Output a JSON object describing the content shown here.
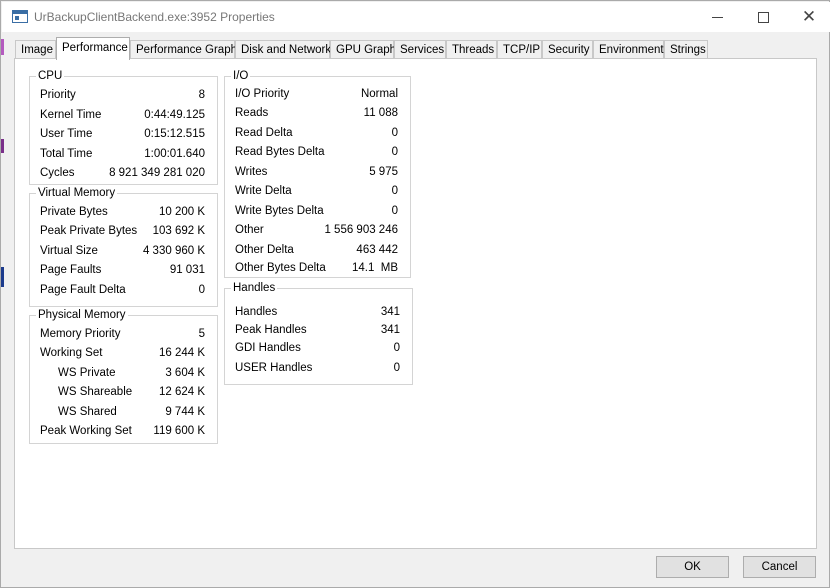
{
  "window": {
    "title": "UrBackupClientBackend.exe:3952 Properties"
  },
  "tabs": [
    {
      "label": "Image"
    },
    {
      "label": "Performance"
    },
    {
      "label": "Performance Graph"
    },
    {
      "label": "Disk and Network"
    },
    {
      "label": "GPU Graph"
    },
    {
      "label": "Services"
    },
    {
      "label": "Threads"
    },
    {
      "label": "TCP/IP"
    },
    {
      "label": "Security"
    },
    {
      "label": "Environment"
    },
    {
      "label": "Strings"
    }
  ],
  "active_tab": "Performance",
  "cpu": {
    "title": "CPU",
    "rows": [
      {
        "label": "Priority",
        "value": "8"
      },
      {
        "label": "Kernel Time",
        "value": "0:44:49.125"
      },
      {
        "label": "User Time",
        "value": "0:15:12.515"
      },
      {
        "label": "Total Time",
        "value": "1:00:01.640"
      },
      {
        "label": "Cycles",
        "value": "8 921 349 281 020"
      }
    ]
  },
  "virtual_memory": {
    "title": "Virtual Memory",
    "rows": [
      {
        "label": "Private Bytes",
        "value": "10 200 K"
      },
      {
        "label": "Peak Private Bytes",
        "value": "103 692 K"
      },
      {
        "label": "Virtual Size",
        "value": "4 330 960 K"
      },
      {
        "label": "Page Faults",
        "value": "91 031"
      },
      {
        "label": "Page Fault Delta",
        "value": "0"
      }
    ]
  },
  "physical_memory": {
    "title": "Physical Memory",
    "rows": [
      {
        "label": "Memory Priority",
        "value": "5"
      },
      {
        "label": "Working Set",
        "value": "16 244 K"
      },
      {
        "label": "WS Private",
        "value": "3 604 K"
      },
      {
        "label": "WS Shareable",
        "value": "12 624 K"
      },
      {
        "label": "WS Shared",
        "value": "9 744 K"
      },
      {
        "label": "Peak Working Set",
        "value": "119 600 K"
      }
    ]
  },
  "io": {
    "title": "I/O",
    "rows": [
      {
        "label": "I/O Priority",
        "value": "Normal"
      },
      {
        "label": "Reads",
        "value": "11 088"
      },
      {
        "label": "Read Delta",
        "value": "0"
      },
      {
        "label": "Read Bytes Delta",
        "value": "0"
      },
      {
        "label": "Writes",
        "value": "5 975"
      },
      {
        "label": "Write Delta",
        "value": "0"
      },
      {
        "label": "Write Bytes Delta",
        "value": "0"
      },
      {
        "label": "Other",
        "value": "1 556 903 246"
      },
      {
        "label": "Other Delta",
        "value": "463 442"
      },
      {
        "label": "Other Bytes Delta",
        "value": "14.1  MB"
      }
    ]
  },
  "handles": {
    "title": "Handles",
    "rows": [
      {
        "label": "Handles",
        "value": "341"
      },
      {
        "label": "Peak Handles",
        "value": "341"
      },
      {
        "label": "GDI Handles",
        "value": "0"
      },
      {
        "label": "USER Handles",
        "value": "0"
      }
    ]
  },
  "buttons": {
    "ok": "OK",
    "cancel": "Cancel"
  },
  "icons": {
    "app": "window-properties-icon",
    "minimize": "minimize-icon",
    "maximize": "maximize-icon",
    "close": "close-icon"
  },
  "colors": {
    "strip_magenta": "#7a2f8a",
    "strip_blue": "#1b3a8c",
    "panel_bg": "#ffffff",
    "window_bg": "#f0f0f0"
  }
}
